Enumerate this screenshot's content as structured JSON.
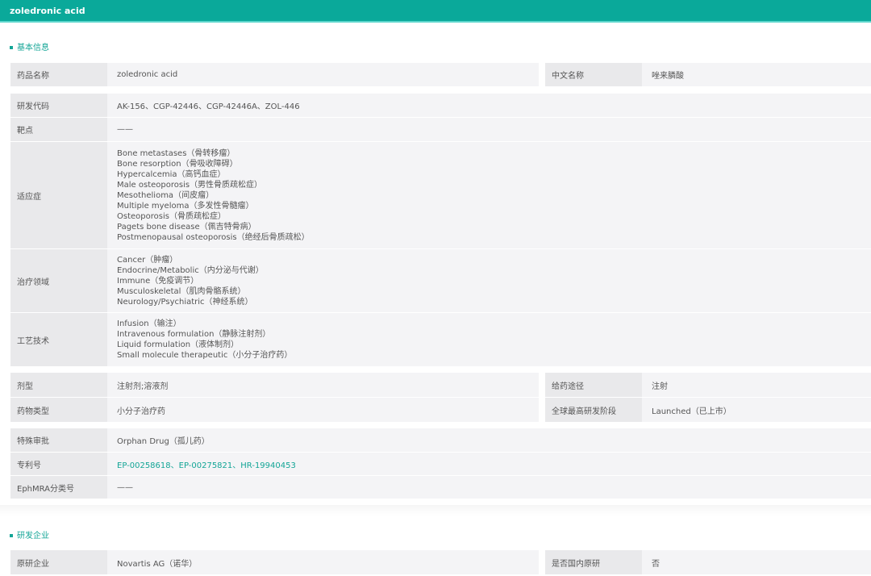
{
  "header": {
    "title": "zoledronic acid"
  },
  "basic": {
    "title": "基本信息",
    "drug_name_label": "药品名称",
    "drug_name": "zoledronic acid",
    "cn_name_label": "中文名称",
    "cn_name": "唑来膦酸",
    "code_label": "研发代码",
    "code": "AK-156、CGP-42446、CGP-42446A、ZOL-446",
    "target_label": "靶点",
    "target": "——",
    "indication_label": "适应症",
    "indications": [
      "Bone metastases（骨转移瘤）",
      "Bone resorption（骨吸收障碍）",
      "Hypercalcemia（高钙血症）",
      "Male osteoporosis（男性骨质疏松症）",
      "Mesothelioma（间皮瘤）",
      "Multiple myeloma（多发性骨髓瘤）",
      "Osteoporosis（骨质疏松症）",
      "Pagets bone disease（佩吉特骨病）",
      "Postmenopausal osteoporosis（绝经后骨质疏松）"
    ],
    "area_label": "治疗领域",
    "areas": [
      "Cancer（肿瘤）",
      "Endocrine/Metabolic（内分泌与代谢）",
      "Immune（免疫调节）",
      "Musculoskeletal（肌肉骨骼系统）",
      "Neurology/Psychiatric（神经系统）"
    ],
    "tech_label": "工艺技术",
    "techs": [
      "Infusion（输注）",
      "Intravenous formulation（静脉注射剂）",
      "Liquid formulation（液体制剂）",
      "Small molecule therapeutic（小分子治疗药）"
    ],
    "form_label": "剂型",
    "form": "注射剂;溶液剂",
    "route_label": "给药途径",
    "route": "注射",
    "type_label": "药物类型",
    "type": "小分子治疗药",
    "phase_label": "全球最高研发阶段",
    "phase": "Launched（已上市）",
    "approval_label": "特殊审批",
    "approval": "Orphan Drug（孤儿药）",
    "patent_label": "专利号",
    "patent": "EP-00258618、EP-00275821、HR-19940453",
    "ephmra_label": "EphMRA分类号",
    "ephmra": "——"
  },
  "company": {
    "title": "研发企业",
    "orig_label": "原研企业",
    "orig": "Novartis AG（诺华）",
    "domestic_label": "是否国内原研",
    "domestic": "否"
  }
}
